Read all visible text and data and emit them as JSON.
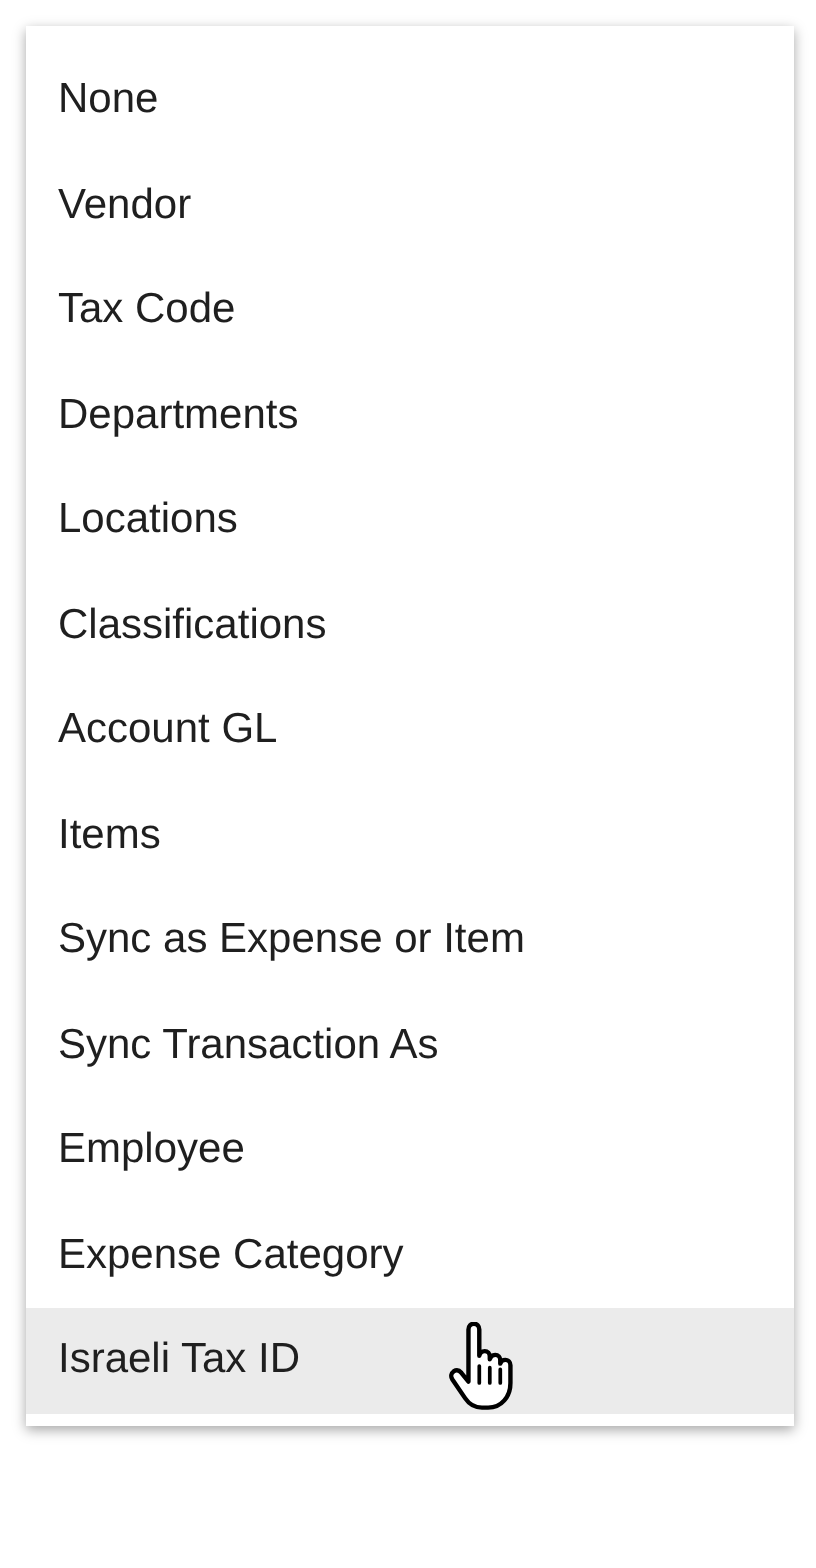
{
  "menu": {
    "items": [
      {
        "label": "None",
        "selected": false
      },
      {
        "label": "Vendor",
        "selected": false
      },
      {
        "label": "Tax Code",
        "selected": false
      },
      {
        "label": "Departments",
        "selected": false
      },
      {
        "label": "Locations",
        "selected": false
      },
      {
        "label": "Classifications",
        "selected": false
      },
      {
        "label": "Account GL",
        "selected": false
      },
      {
        "label": "Items",
        "selected": false
      },
      {
        "label": "Sync as Expense or Item",
        "selected": false
      },
      {
        "label": "Sync Transaction As",
        "selected": false
      },
      {
        "label": "Employee",
        "selected": false
      },
      {
        "label": "Expense Category",
        "selected": false
      },
      {
        "label": "Israeli Tax ID",
        "selected": true
      }
    ]
  }
}
